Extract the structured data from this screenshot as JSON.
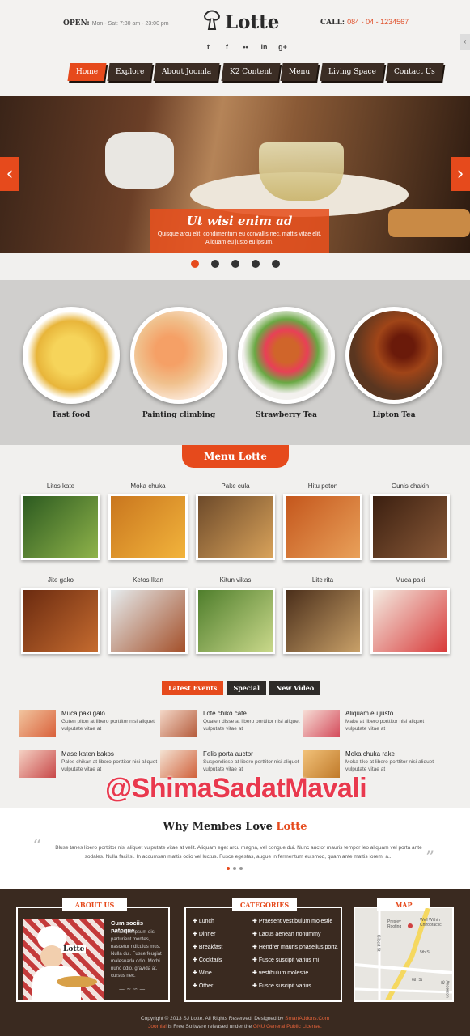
{
  "header": {
    "open_label": "OPEN:",
    "open_hours": "Mon - Sat: 7:30 am - 23:00 pm",
    "call_label": "CALL:",
    "call_number": "084 - 04 - 1234567",
    "logo": "Lotte",
    "social": [
      "twitter-icon",
      "facebook-icon",
      "flickr-icon",
      "linkedin-icon",
      "googleplus-icon"
    ],
    "social_glyphs": [
      "t",
      "f",
      "••",
      "in",
      "g+"
    ]
  },
  "nav": [
    "Home",
    "Explore",
    "About Joomla",
    "K2 Content",
    "Menu",
    "Living Space",
    "Contact Us"
  ],
  "slider": {
    "title": "Ut wisi enim ad",
    "text_1": "Quisque arcu elit, condimentum eu convallis nec, mattis vitae elit.",
    "text_2": "Aliquam eu justo eu ipsum.",
    "prev": "‹",
    "next": "›",
    "active_dot": 0
  },
  "circles": [
    "Fast food",
    "Painting climbing",
    "Strawberry Tea",
    "Lipton Tea"
  ],
  "menu_title": "Menu Lotte",
  "menu_row_1": [
    "Litos kate",
    "Moka chuka",
    "Pake cula",
    "Hitu peton",
    "Gunis chakin"
  ],
  "menu_row_2": [
    "Jite gako",
    "Ketos Ikan",
    "Kitun vikas",
    "Lite rita",
    "Muca paki"
  ],
  "tabs": [
    "Latest Events",
    "Special",
    "New Video"
  ],
  "events": [
    {
      "title": "Muca paki galo",
      "text": "Guten piton at libero porttitor nisi aliquet vulputate vitae at"
    },
    {
      "title": "Lote chiko cate",
      "text": "Quaten disse at libero porttitor nisi aliquet vulputate vitae at"
    },
    {
      "title": "Aliquam eu justo",
      "text": "Make at libero porttitor nisi aliquet vulputate vitae at"
    },
    {
      "title": "Mase katen bakos",
      "text": "Pales chikan at libero porttitor nisi aliquet vulputate vitae at"
    },
    {
      "title": "Felis porta auctor",
      "text": "Suspendisse at libero porttitor nisi aliquet vulputate vitae at"
    },
    {
      "title": "Moka chuka rake",
      "text": "Moka tiko at libero porttitor nisi aliquet vulputate vitae at"
    }
  ],
  "watermark": "@ShimaSadatMavali",
  "testimonial": {
    "title_prefix": "Why Membes Love",
    "title_brand": "Lotte",
    "text": "Bluse tanes libero porttitor nisi aliquet vulputate vitae at velit. Aliquam eget arcu magna, vel congue dui. Nunc auctor mauris tempor leo aliquam vel porta ante sodales. Nulla facilisi. In accumsan mattis odio vel luctus. Fusce egestas, augue in fermentum euismod, quam ante mattis lorem, a..."
  },
  "footer": {
    "about_title": "ABOUT US",
    "about_heading": "Cum sociis natoque",
    "about_text": "Penatibus ipsum dis parturient montes, nascetur ridiculus mus. Nulla dui. Fusce feugiat malesuada odio. Morbi nunc odio, gravida at, cursus nec.",
    "about_badge": "Lotte",
    "categories_title": "CATEGORIES",
    "categories_left": [
      "Lunch",
      "Dinner",
      "Breakfast",
      "Cocktails",
      "Wine",
      "Other"
    ],
    "categories_right": [
      "Praesent vestibulum molestie",
      "Lacus aenean nonummy",
      "Hendrer mauris phasellus porta",
      "Fusce suscipit varius mi",
      "vestibulum molestie",
      "Fusce suscipit varius"
    ],
    "map_title": "MAP",
    "map_labels": [
      "Presley Roofing",
      "Well Within Chiropractic",
      "Gilbert St",
      "5th St",
      "6th St",
      "Anderson St"
    ],
    "copyright_1": "Copyright © 2013 SJ Lotte. All Rights Reserved. Designed by",
    "copyright_link": "SmartAddons.Com",
    "copyright_2a": "Joomla!",
    "copyright_2b": "is Free Software released under the",
    "copyright_2c": "GNU General Public License."
  }
}
